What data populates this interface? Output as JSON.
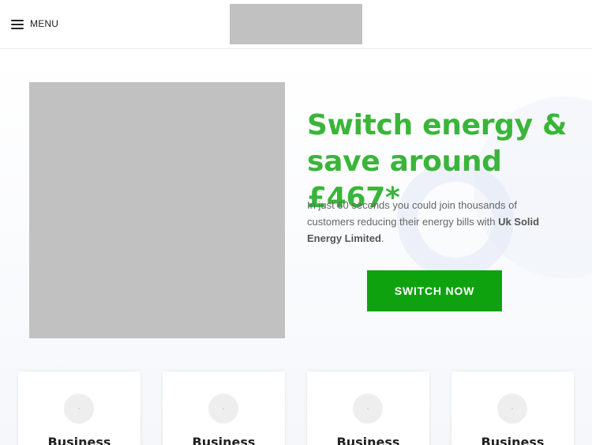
{
  "header": {
    "menu_label": "MENU",
    "menu_icon": "hamburger-icon",
    "logo_alt": "logo placeholder"
  },
  "hero": {
    "headline": "Switch energy & save around £467*",
    "intro_prefix": "In just 60 seconds you could join thousands of customers reducing their energy bills with ",
    "intro_company": "Uk Solid Energy Limited",
    "intro_suffix": ".",
    "cta_label": "SWITCH NOW"
  },
  "cards": [
    {
      "title": "Business"
    },
    {
      "title": "Business"
    },
    {
      "title": "Business"
    },
    {
      "title": "Business"
    }
  ],
  "colors": {
    "headline_green": "#3ab53a",
    "cta_green": "#0ea30e",
    "placeholder_gray": "#c1c1c1"
  }
}
